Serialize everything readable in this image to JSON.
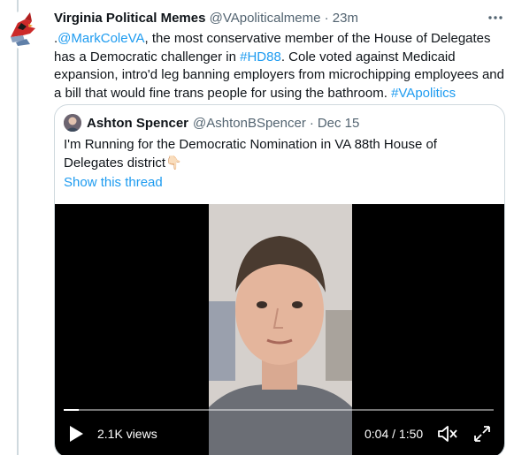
{
  "tweet": {
    "display_name": "Virginia Political Memes",
    "handle": "@VApoliticalmeme",
    "separator": "·",
    "time": "23m",
    "avatar_icon": "cardinal-icon",
    "body": {
      "prefix": ".",
      "mention": "@MarkColeVA",
      "text1": ", the most conservative member of the House of Delegates has a Democratic challenger in ",
      "hashtag1": "#HD88",
      "text2": ". Cole voted against Medicaid expansion, intro'd leg banning employers from microchipping employees and a bill that would fine trans people for using the bathroom. ",
      "hashtag2": "#VApolitics"
    }
  },
  "quote": {
    "display_name": "Ashton Spencer",
    "handle": "@AshtonBSpencer",
    "separator": "·",
    "date": "Dec 15",
    "text": "I'm Running for the Democratic Nomination in VA 88th House of Delegates district",
    "emoji": "👇🏻",
    "show_thread": "Show this thread",
    "video": {
      "views": "2.1K views",
      "timecode": "0:04 / 1:50",
      "progress": 0.036
    }
  },
  "colors": {
    "link": "#1d9bf0",
    "secondary": "#536471",
    "border": "#cfd9de"
  }
}
